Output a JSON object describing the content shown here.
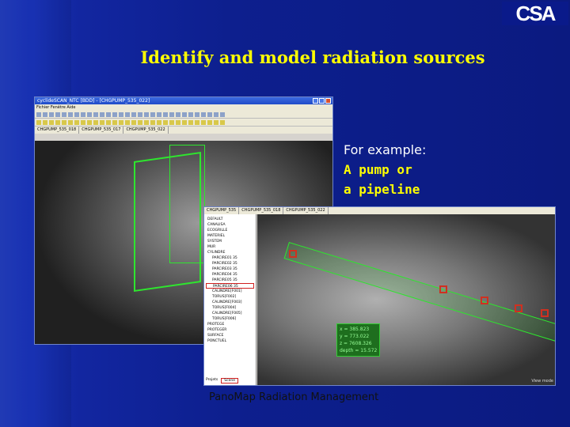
{
  "logo": "CSA",
  "title": "Identify and model radiation sources",
  "example": {
    "intro": "For example:",
    "line1": "A pump or",
    "line2": "a pipeline"
  },
  "caption": "PanoMap Radiation Management",
  "window1": {
    "title": "cyclideSCAN_NTC  [BDD] - [CHGPUMP_535_022]",
    "menu": "Fichier  Fenêtre  Aide",
    "tabs": [
      "CHGPUMP_535_018",
      "CHGPUMP_535_017",
      "CHGPUMP_535_022"
    ]
  },
  "window2": {
    "tabs": [
      "CHGPUMP_535",
      "CHGPUMP_535_018",
      "CHGPUMP_535_022"
    ],
    "tree": [
      "DEFAULT",
      "CANALISA",
      "ECOGRILLE",
      "MATERIEL",
      "SYSTEM",
      "MUR",
      "CYLINDRE",
      "PARCIRE01 35",
      "PARCIRE02 35",
      "PARCIRE03 35",
      "PARCIRE04 35",
      "PARCIRE05 35",
      "PARCIRE06 35",
      "CALINDRE[F001]",
      "TORUS[F002]",
      "CALINDRE[F003]",
      "TORUS[F004]",
      "CALINDRE[F005]",
      "TORUS[F006]",
      "PROTEGE",
      "PROTEGER",
      "SURFACE",
      "PONCTUEL"
    ],
    "selected_index": 12,
    "bottom_tabs": [
      "Projets",
      "Scene"
    ],
    "readout": [
      "x = 385.823",
      "y = 773.022",
      "z = 7608.326",
      "depth = 15.572"
    ],
    "view_label": "View mode"
  }
}
